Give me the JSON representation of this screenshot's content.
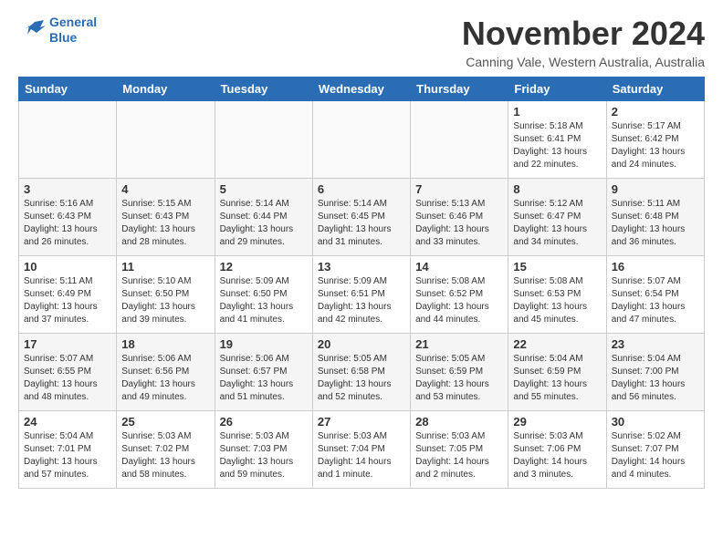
{
  "header": {
    "logo_line1": "General",
    "logo_line2": "Blue",
    "month_title": "November 2024",
    "subtitle": "Canning Vale, Western Australia, Australia"
  },
  "weekdays": [
    "Sunday",
    "Monday",
    "Tuesday",
    "Wednesday",
    "Thursday",
    "Friday",
    "Saturday"
  ],
  "weeks": [
    [
      {
        "day": "",
        "info": ""
      },
      {
        "day": "",
        "info": ""
      },
      {
        "day": "",
        "info": ""
      },
      {
        "day": "",
        "info": ""
      },
      {
        "day": "",
        "info": ""
      },
      {
        "day": "1",
        "info": "Sunrise: 5:18 AM\nSunset: 6:41 PM\nDaylight: 13 hours\nand 22 minutes."
      },
      {
        "day": "2",
        "info": "Sunrise: 5:17 AM\nSunset: 6:42 PM\nDaylight: 13 hours\nand 24 minutes."
      }
    ],
    [
      {
        "day": "3",
        "info": "Sunrise: 5:16 AM\nSunset: 6:43 PM\nDaylight: 13 hours\nand 26 minutes."
      },
      {
        "day": "4",
        "info": "Sunrise: 5:15 AM\nSunset: 6:43 PM\nDaylight: 13 hours\nand 28 minutes."
      },
      {
        "day": "5",
        "info": "Sunrise: 5:14 AM\nSunset: 6:44 PM\nDaylight: 13 hours\nand 29 minutes."
      },
      {
        "day": "6",
        "info": "Sunrise: 5:14 AM\nSunset: 6:45 PM\nDaylight: 13 hours\nand 31 minutes."
      },
      {
        "day": "7",
        "info": "Sunrise: 5:13 AM\nSunset: 6:46 PM\nDaylight: 13 hours\nand 33 minutes."
      },
      {
        "day": "8",
        "info": "Sunrise: 5:12 AM\nSunset: 6:47 PM\nDaylight: 13 hours\nand 34 minutes."
      },
      {
        "day": "9",
        "info": "Sunrise: 5:11 AM\nSunset: 6:48 PM\nDaylight: 13 hours\nand 36 minutes."
      }
    ],
    [
      {
        "day": "10",
        "info": "Sunrise: 5:11 AM\nSunset: 6:49 PM\nDaylight: 13 hours\nand 37 minutes."
      },
      {
        "day": "11",
        "info": "Sunrise: 5:10 AM\nSunset: 6:50 PM\nDaylight: 13 hours\nand 39 minutes."
      },
      {
        "day": "12",
        "info": "Sunrise: 5:09 AM\nSunset: 6:50 PM\nDaylight: 13 hours\nand 41 minutes."
      },
      {
        "day": "13",
        "info": "Sunrise: 5:09 AM\nSunset: 6:51 PM\nDaylight: 13 hours\nand 42 minutes."
      },
      {
        "day": "14",
        "info": "Sunrise: 5:08 AM\nSunset: 6:52 PM\nDaylight: 13 hours\nand 44 minutes."
      },
      {
        "day": "15",
        "info": "Sunrise: 5:08 AM\nSunset: 6:53 PM\nDaylight: 13 hours\nand 45 minutes."
      },
      {
        "day": "16",
        "info": "Sunrise: 5:07 AM\nSunset: 6:54 PM\nDaylight: 13 hours\nand 47 minutes."
      }
    ],
    [
      {
        "day": "17",
        "info": "Sunrise: 5:07 AM\nSunset: 6:55 PM\nDaylight: 13 hours\nand 48 minutes."
      },
      {
        "day": "18",
        "info": "Sunrise: 5:06 AM\nSunset: 6:56 PM\nDaylight: 13 hours\nand 49 minutes."
      },
      {
        "day": "19",
        "info": "Sunrise: 5:06 AM\nSunset: 6:57 PM\nDaylight: 13 hours\nand 51 minutes."
      },
      {
        "day": "20",
        "info": "Sunrise: 5:05 AM\nSunset: 6:58 PM\nDaylight: 13 hours\nand 52 minutes."
      },
      {
        "day": "21",
        "info": "Sunrise: 5:05 AM\nSunset: 6:59 PM\nDaylight: 13 hours\nand 53 minutes."
      },
      {
        "day": "22",
        "info": "Sunrise: 5:04 AM\nSunset: 6:59 PM\nDaylight: 13 hours\nand 55 minutes."
      },
      {
        "day": "23",
        "info": "Sunrise: 5:04 AM\nSunset: 7:00 PM\nDaylight: 13 hours\nand 56 minutes."
      }
    ],
    [
      {
        "day": "24",
        "info": "Sunrise: 5:04 AM\nSunset: 7:01 PM\nDaylight: 13 hours\nand 57 minutes."
      },
      {
        "day": "25",
        "info": "Sunrise: 5:03 AM\nSunset: 7:02 PM\nDaylight: 13 hours\nand 58 minutes."
      },
      {
        "day": "26",
        "info": "Sunrise: 5:03 AM\nSunset: 7:03 PM\nDaylight: 13 hours\nand 59 minutes."
      },
      {
        "day": "27",
        "info": "Sunrise: 5:03 AM\nSunset: 7:04 PM\nDaylight: 14 hours\nand 1 minute."
      },
      {
        "day": "28",
        "info": "Sunrise: 5:03 AM\nSunset: 7:05 PM\nDaylight: 14 hours\nand 2 minutes."
      },
      {
        "day": "29",
        "info": "Sunrise: 5:03 AM\nSunset: 7:06 PM\nDaylight: 14 hours\nand 3 minutes."
      },
      {
        "day": "30",
        "info": "Sunrise: 5:02 AM\nSunset: 7:07 PM\nDaylight: 14 hours\nand 4 minutes."
      }
    ]
  ]
}
